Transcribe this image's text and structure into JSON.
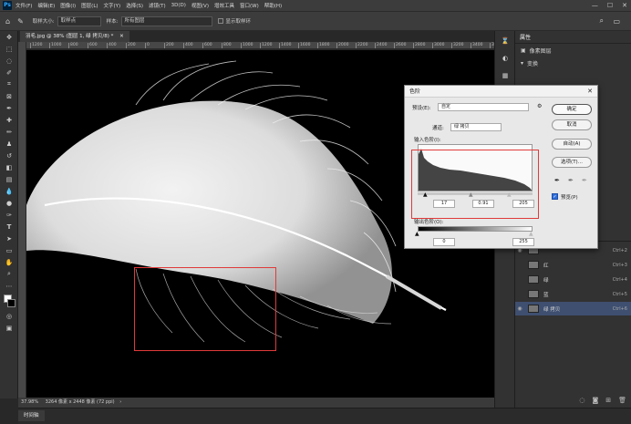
{
  "menu": {
    "logo": "Ps",
    "items": [
      "文件(F)",
      "编辑(E)",
      "图像(I)",
      "图层(L)",
      "文字(Y)",
      "选择(S)",
      "滤镜(T)",
      "3D(D)",
      "视图(V)",
      "增效工具",
      "窗口(W)",
      "帮助(H)"
    ]
  },
  "options_bar": {
    "sample_size_label": "取样大小:",
    "sample_size_value": "取样点",
    "sample_label": "样本:",
    "sample_value": "所有图层",
    "show_ring_label": "显示取样环"
  },
  "document": {
    "tab_title": "羽毛.jpg @ 38% (图层 1, 绿 拷贝/8) *",
    "ruler_ticks": [
      "1200",
      "1000",
      "800",
      "600",
      "400",
      "200",
      "0",
      "200",
      "400",
      "600",
      "800",
      "1000",
      "1200",
      "1400",
      "1600",
      "1800",
      "2000",
      "2200",
      "2400",
      "2600",
      "2800",
      "3000",
      "3200",
      "3400",
      "3600"
    ],
    "status_zoom": "37.98%",
    "status_info": "3264 像素 x 2448 像素 (72 ppi)",
    "timeline_tab": "时间轴"
  },
  "properties": {
    "tab": "属性",
    "mask_label": "像素图层",
    "transform_label": "变换"
  },
  "channels": [
    {
      "name": "",
      "shortcut": "Ctrl+2",
      "selected": false,
      "visible": true
    },
    {
      "name": "红",
      "shortcut": "Ctrl+3",
      "selected": false,
      "visible": false
    },
    {
      "name": "绿",
      "shortcut": "Ctrl+4",
      "selected": false,
      "visible": false
    },
    {
      "name": "蓝",
      "shortcut": "Ctrl+5",
      "selected": false,
      "visible": false
    },
    {
      "name": "绿 拷贝",
      "shortcut": "Ctrl+6",
      "selected": true,
      "visible": true
    }
  ],
  "levels_dialog": {
    "title": "色阶",
    "preset_label": "预设(E):",
    "preset_value": "自定",
    "channel_label": "通道:",
    "channel_value": "绿 拷贝",
    "input_label": "输入色阶(I):",
    "input_black": "17",
    "input_gamma": "0.91",
    "input_white": "205",
    "output_label": "输出色阶(O):",
    "output_black": "0",
    "output_white": "255",
    "ok": "确定",
    "cancel": "取消",
    "auto": "自动(A)",
    "options": "选项(T)...",
    "preview_label": "预览(P)",
    "preview_checked": true
  },
  "colors": {
    "highlight": "#e03a3a",
    "selected_channel": "#3e4f70"
  }
}
